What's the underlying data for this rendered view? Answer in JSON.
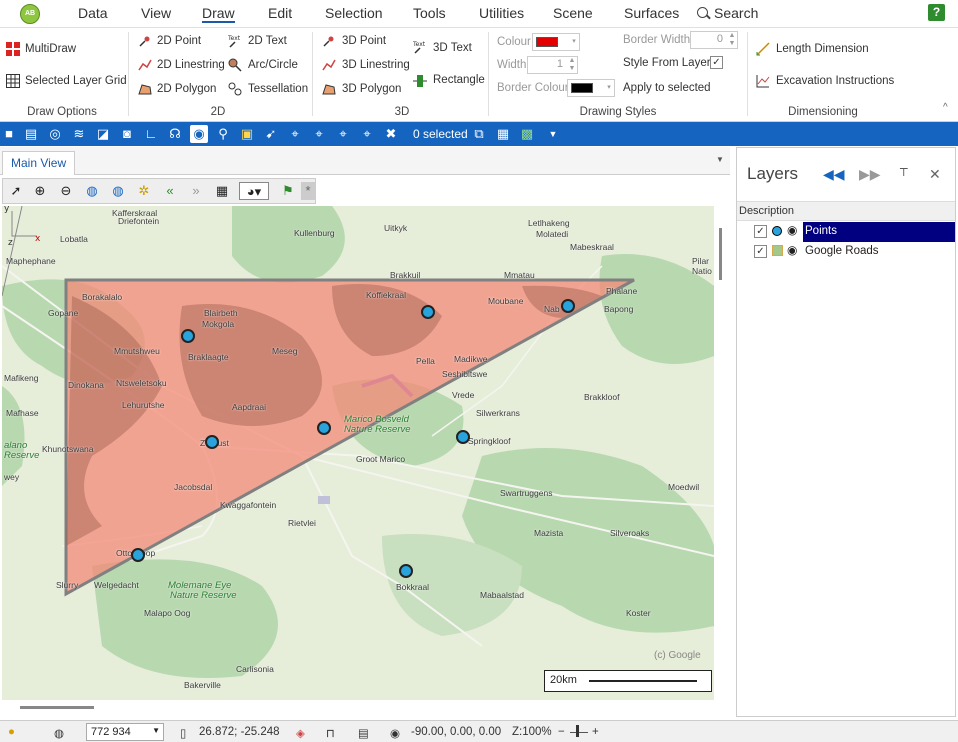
{
  "app": {
    "logo_text": "AB"
  },
  "menu": {
    "items": [
      "Data",
      "View",
      "Draw",
      "Edit",
      "Selection",
      "Tools",
      "Utilities",
      "Scene",
      "Surfaces"
    ],
    "active": "Draw",
    "search_label": "Search",
    "help_label": "?"
  },
  "ribbon": {
    "draw_options": {
      "multidraw": "MultiDraw",
      "selected_layer_grid": "Selected Layer Grid",
      "group_label": "Draw Options"
    },
    "draw2d": {
      "point": "2D Point",
      "linestring": "2D Linestring",
      "polygon": "2D Polygon",
      "text": "2D Text",
      "arc": "Arc/Circle",
      "tessellation": "Tessellation",
      "group_label": "2D"
    },
    "draw3d": {
      "point": "3D Point",
      "linestring": "3D Linestring",
      "polygon": "3D Polygon",
      "text": "3D Text",
      "rectangle": "Rectangle",
      "group_label": "3D"
    },
    "styles": {
      "colour_label": "Colour",
      "width_label": "Width",
      "width_value": "1",
      "border_colour_label": "Border Colour",
      "border_width_label": "Border Width",
      "border_width_value": "0",
      "style_from_layer": "Style From Layer",
      "apply_to_selected": "Apply to selected",
      "colour_value": "#e30000",
      "border_colour_value": "#000000",
      "group_label": "Drawing Styles"
    },
    "dimensioning": {
      "length": "Length Dimension",
      "excavation": "Excavation Instructions",
      "group_label": "Dimensioning"
    }
  },
  "toolbar": {
    "selected_text": "0 selected"
  },
  "tabs": {
    "main_view": "Main View"
  },
  "map": {
    "places": [
      {
        "name": "Kafferskraal",
        "cls": ""
      },
      {
        "name": "Driefontein",
        "cls": ""
      },
      {
        "name": "Lobatla",
        "cls": ""
      },
      {
        "name": "Kullenburg",
        "cls": ""
      },
      {
        "name": "Uitkyk",
        "cls": ""
      },
      {
        "name": "Letlhakeng",
        "cls": ""
      },
      {
        "name": "Molatedi",
        "cls": ""
      },
      {
        "name": "Mabeskraal",
        "cls": ""
      },
      {
        "name": "Maphephane",
        "cls": ""
      },
      {
        "name": "Brakkuil",
        "cls": ""
      },
      {
        "name": "Mmatau",
        "cls": ""
      },
      {
        "name": "Koffiekraal",
        "cls": ""
      },
      {
        "name": "Borakalalo",
        "cls": ""
      },
      {
        "name": "Moubane",
        "cls": ""
      },
      {
        "name": "Nab",
        "cls": ""
      },
      {
        "name": "Phalane",
        "cls": ""
      },
      {
        "name": "Bapong",
        "cls": ""
      },
      {
        "name": "Gopane",
        "cls": ""
      },
      {
        "name": "Blairbeth",
        "cls": ""
      },
      {
        "name": "Mokgola",
        "cls": ""
      },
      {
        "name": "Mmutshweu",
        "cls": ""
      },
      {
        "name": "Braklaagte",
        "cls": ""
      },
      {
        "name": "Meseg",
        "cls": ""
      },
      {
        "name": "Pella",
        "cls": ""
      },
      {
        "name": "Madikwe",
        "cls": ""
      },
      {
        "name": "Seshibitswe",
        "cls": ""
      },
      {
        "name": "Dinokana",
        "cls": ""
      },
      {
        "name": "Ntsweletsoku",
        "cls": ""
      },
      {
        "name": "Mafikeng",
        "cls": ""
      },
      {
        "name": "Vrede",
        "cls": ""
      },
      {
        "name": "Brakkloof",
        "cls": ""
      },
      {
        "name": "Lehurutshe",
        "cls": ""
      },
      {
        "name": "Aapdraai",
        "cls": ""
      },
      {
        "name": "Marico Bosveld",
        "cls": "green"
      },
      {
        "name": "Nature Reserve",
        "cls": "green"
      },
      {
        "name": "Silwerkrans",
        "cls": ""
      },
      {
        "name": "Mafhase",
        "cls": ""
      },
      {
        "name": "Zeerust",
        "cls": ""
      },
      {
        "name": "Springkloof",
        "cls": ""
      },
      {
        "name": "alano",
        "cls": "green"
      },
      {
        "name": "Khunotswana",
        "cls": ""
      },
      {
        "name": "Reserve",
        "cls": "green"
      },
      {
        "name": "Groot Marico",
        "cls": ""
      },
      {
        "name": "wey",
        "cls": ""
      },
      {
        "name": "Jacobsdal",
        "cls": ""
      },
      {
        "name": "Swartruggens",
        "cls": ""
      },
      {
        "name": "Moedwil",
        "cls": ""
      },
      {
        "name": "Kwaggafontein",
        "cls": ""
      },
      {
        "name": "Rietvlei",
        "cls": ""
      },
      {
        "name": "Mazista",
        "cls": ""
      },
      {
        "name": "Silveroaks",
        "cls": ""
      },
      {
        "name": "Ottoshoop",
        "cls": ""
      },
      {
        "name": "Welgedacht",
        "cls": ""
      },
      {
        "name": "Slurry",
        "cls": ""
      },
      {
        "name": "Molemane Eye",
        "cls": "green"
      },
      {
        "name": "Nature Reserve",
        "cls": "green"
      },
      {
        "name": "Bokkraal",
        "cls": ""
      },
      {
        "name": "Mabaalstad",
        "cls": ""
      },
      {
        "name": "Malapo Oog",
        "cls": ""
      },
      {
        "name": "Koster",
        "cls": ""
      },
      {
        "name": "Carlisonia",
        "cls": ""
      },
      {
        "name": "Bakerville",
        "cls": ""
      },
      {
        "name": "Pilar",
        "cls": ""
      },
      {
        "name": "Natio",
        "cls": ""
      }
    ],
    "google_label": "(c) Google",
    "scale_label": "20km"
  },
  "layers": {
    "title": "Layers",
    "column_header": "Description",
    "items": [
      {
        "name": "Points",
        "checked": true,
        "selected": true
      },
      {
        "name": "Google Roads",
        "checked": true,
        "selected": false
      }
    ]
  },
  "status": {
    "zoom_value": "772 934",
    "coords": "26.872; -25.248",
    "camera": "-90.00, 0.00, 0.00",
    "zoom_percent": "Z:100%"
  }
}
